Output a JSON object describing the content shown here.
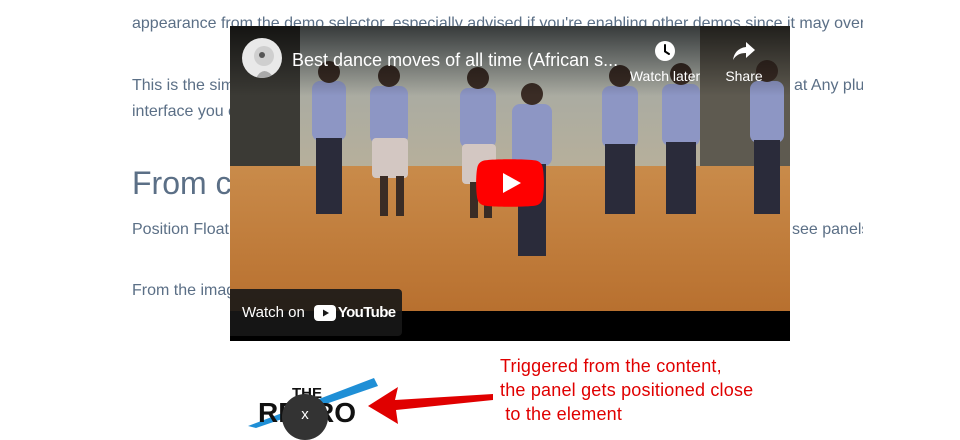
{
  "article": {
    "paragraph_1": "appearance from the demo selector, especially advised if you're enabling other demos since it may override",
    "paragraph_2_left": "This is the sim",
    "paragraph_2_right": "at Any plugin",
    "paragraph_2_line2": "interface you c",
    "heading": "From c",
    "paragraph_3_left": "Position Float",
    "paragraph_3_right": "see panels",
    "paragraph_4": "From the imag"
  },
  "video": {
    "title": "Best dance moves of all time (African s...",
    "watch_later_label": "Watch later",
    "share_label": "Share",
    "watch_on_label": "Watch on",
    "youtube_wordmark": "YouTube",
    "brand_red": "#ff0000"
  },
  "annotation": {
    "text": "Triggered from the content,\nthe panel gets positioned close\n to the element",
    "color": "#e00000"
  },
  "logo": {
    "line1": "THE",
    "line2": "RETRO"
  },
  "close_button": {
    "label": "x"
  }
}
